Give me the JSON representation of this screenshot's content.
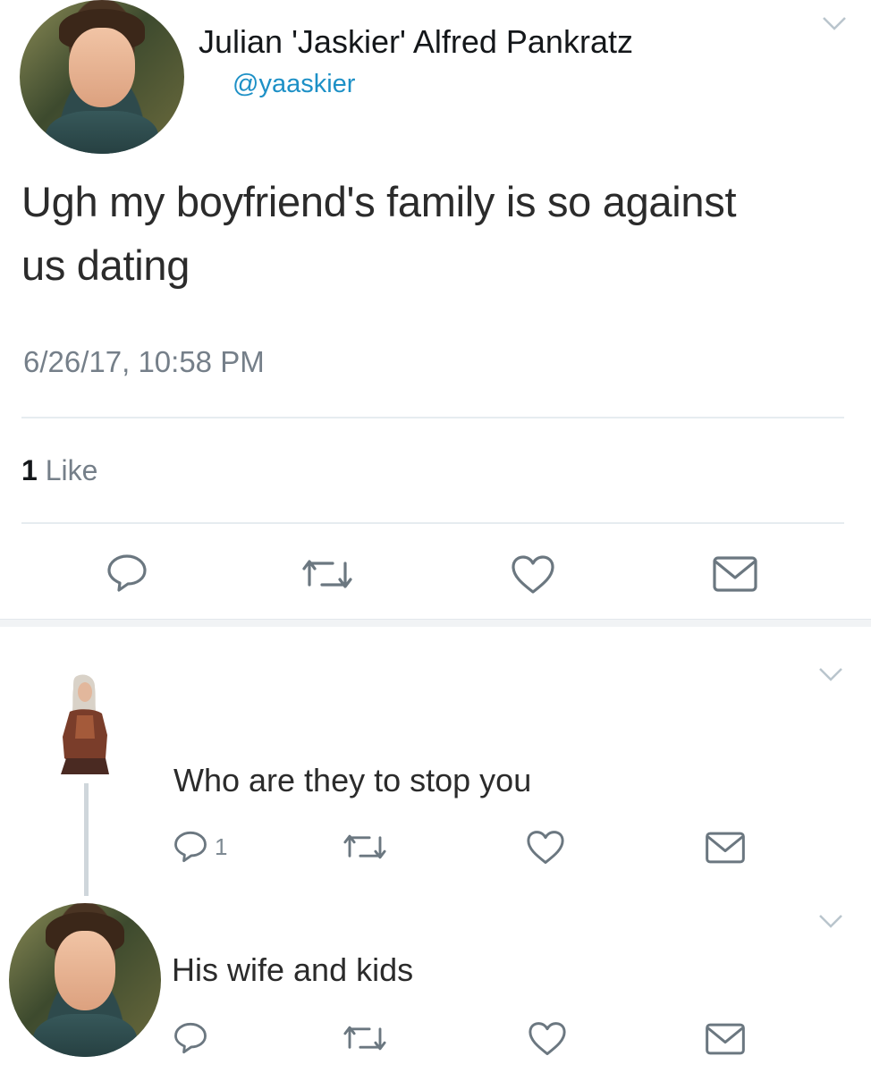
{
  "tweet": {
    "author_name": "Julian 'Jaskier' Alfred Pankratz",
    "handle": "@yaaskier",
    "text": "Ugh my boyfriend's family is so against us dating",
    "timestamp": "6/26/17, 10:58 PM",
    "likes_count": "1",
    "likes_label": "Like"
  },
  "replies": [
    {
      "text": "Who are they to stop you",
      "reply_count": "1"
    },
    {
      "text": "His wife and kids",
      "reply_count": ""
    }
  ],
  "icons": [
    "reply-icon",
    "retweet-icon",
    "like-icon",
    "message-icon",
    "chevron-down-icon"
  ],
  "colors": {
    "handle": "#1d90c6",
    "meta": "#757f89",
    "icon": "#6b7780",
    "divider": "#e6ecf0"
  }
}
